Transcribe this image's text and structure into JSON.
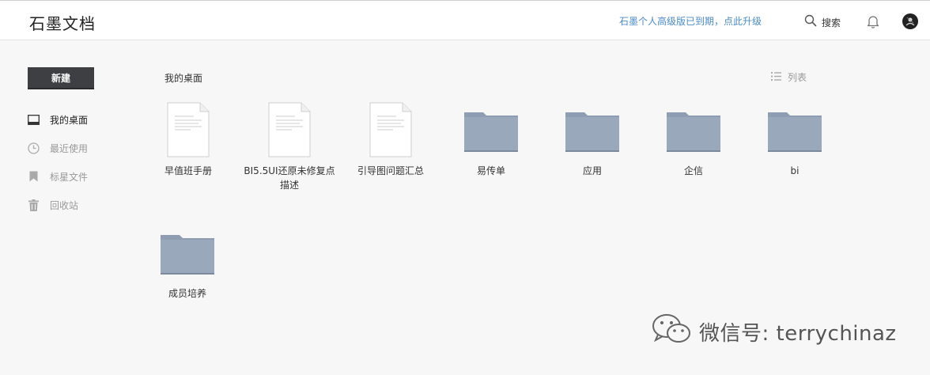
{
  "header": {
    "logo": "石墨文档",
    "upgrade_notice": "石墨个人高级版已到期，点此升级",
    "search_label": "搜索"
  },
  "sidebar": {
    "new_button": "新建",
    "items": [
      {
        "label": "我的桌面",
        "icon": "desktop-icon",
        "active": true
      },
      {
        "label": "最近使用",
        "icon": "clock-icon",
        "active": false
      },
      {
        "label": "标星文件",
        "icon": "bookmark-icon",
        "active": false
      },
      {
        "label": "回收站",
        "icon": "trash-icon",
        "active": false
      }
    ]
  },
  "main": {
    "title": "我的桌面",
    "view_toggle": "列表",
    "files": [
      {
        "name": "早值班手册",
        "type": "document"
      },
      {
        "name": "BI5.5UI还原未修复点描述",
        "type": "document"
      },
      {
        "name": "引导图问题汇总",
        "type": "document"
      },
      {
        "name": "易传单",
        "type": "folder"
      },
      {
        "name": "应用",
        "type": "folder"
      },
      {
        "name": "企信",
        "type": "folder"
      },
      {
        "name": "bi",
        "type": "folder"
      },
      {
        "name": "成员培养",
        "type": "folder"
      }
    ]
  },
  "watermark": {
    "text": "微信号: terrychinaz",
    "icon": "wechat-icon"
  },
  "colors": {
    "accent_link": "#4a8bc8",
    "folder": "#9aa8bb",
    "new_button_bg": "#3d3f43"
  }
}
